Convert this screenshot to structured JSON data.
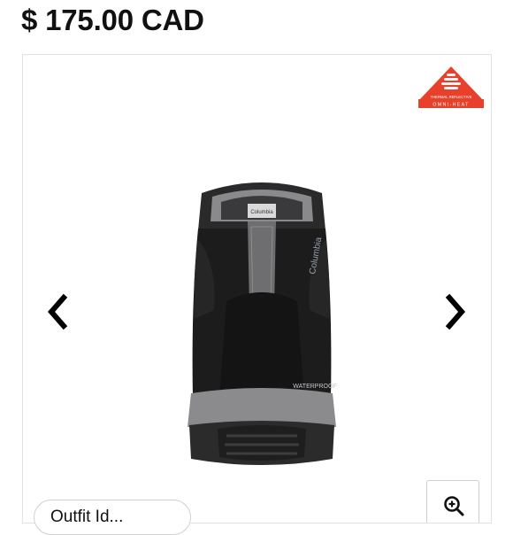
{
  "product": {
    "price": "$ 175.00 CAD"
  },
  "gallery": {
    "badge_text_line1": "THERMAL REFLECTIVE",
    "badge_text_line2": "OMNI-HEAT",
    "boot_label_brand": "Columbia",
    "boot_label_waterproof": "WATERPROOF"
  },
  "icons": {
    "prev": "chevron-left-icon",
    "next": "chevron-right-icon",
    "zoom": "zoom-in-icon"
  },
  "outfit_button": {
    "label": "Outfit Id..."
  },
  "colors": {
    "badge_red": "#e8402a",
    "boot_black": "#1a1a1a",
    "boot_gray": "#6e6e70"
  }
}
